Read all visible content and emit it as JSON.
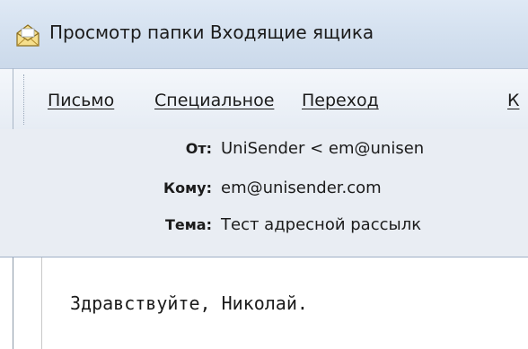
{
  "window": {
    "title": "Просмотр папки Входящие ящика",
    "icon": "envelope-folder-icon"
  },
  "menu": {
    "items": [
      {
        "label": "Письмо"
      },
      {
        "label": "Специальное"
      },
      {
        "label": "Переход"
      },
      {
        "label": "К"
      }
    ]
  },
  "header": {
    "from_label": "От:",
    "from_value": "UniSender < em@unisen",
    "to_label": "Кому:",
    "to_value": "em@unisender.com",
    "subject_label": "Тема:",
    "subject_value": "Тест адресной рассылк"
  },
  "message": {
    "body": "Здравствуйте, Николай."
  }
}
